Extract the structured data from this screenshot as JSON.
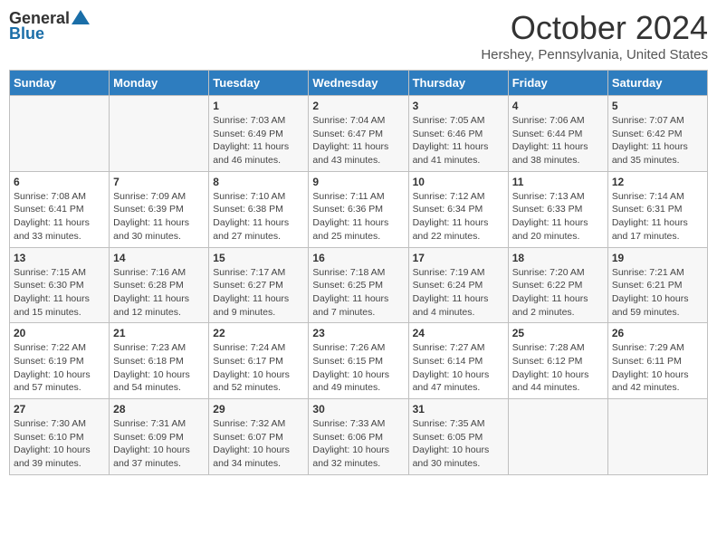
{
  "header": {
    "logo_general": "General",
    "logo_blue": "Blue",
    "title": "October 2024",
    "location": "Hershey, Pennsylvania, United States"
  },
  "days_of_week": [
    "Sunday",
    "Monday",
    "Tuesday",
    "Wednesday",
    "Thursday",
    "Friday",
    "Saturday"
  ],
  "weeks": [
    [
      {
        "day": "",
        "info": ""
      },
      {
        "day": "",
        "info": ""
      },
      {
        "day": "1",
        "info": "Sunrise: 7:03 AM\nSunset: 6:49 PM\nDaylight: 11 hours and 46 minutes."
      },
      {
        "day": "2",
        "info": "Sunrise: 7:04 AM\nSunset: 6:47 PM\nDaylight: 11 hours and 43 minutes."
      },
      {
        "day": "3",
        "info": "Sunrise: 7:05 AM\nSunset: 6:46 PM\nDaylight: 11 hours and 41 minutes."
      },
      {
        "day": "4",
        "info": "Sunrise: 7:06 AM\nSunset: 6:44 PM\nDaylight: 11 hours and 38 minutes."
      },
      {
        "day": "5",
        "info": "Sunrise: 7:07 AM\nSunset: 6:42 PM\nDaylight: 11 hours and 35 minutes."
      }
    ],
    [
      {
        "day": "6",
        "info": "Sunrise: 7:08 AM\nSunset: 6:41 PM\nDaylight: 11 hours and 33 minutes."
      },
      {
        "day": "7",
        "info": "Sunrise: 7:09 AM\nSunset: 6:39 PM\nDaylight: 11 hours and 30 minutes."
      },
      {
        "day": "8",
        "info": "Sunrise: 7:10 AM\nSunset: 6:38 PM\nDaylight: 11 hours and 27 minutes."
      },
      {
        "day": "9",
        "info": "Sunrise: 7:11 AM\nSunset: 6:36 PM\nDaylight: 11 hours and 25 minutes."
      },
      {
        "day": "10",
        "info": "Sunrise: 7:12 AM\nSunset: 6:34 PM\nDaylight: 11 hours and 22 minutes."
      },
      {
        "day": "11",
        "info": "Sunrise: 7:13 AM\nSunset: 6:33 PM\nDaylight: 11 hours and 20 minutes."
      },
      {
        "day": "12",
        "info": "Sunrise: 7:14 AM\nSunset: 6:31 PM\nDaylight: 11 hours and 17 minutes."
      }
    ],
    [
      {
        "day": "13",
        "info": "Sunrise: 7:15 AM\nSunset: 6:30 PM\nDaylight: 11 hours and 15 minutes."
      },
      {
        "day": "14",
        "info": "Sunrise: 7:16 AM\nSunset: 6:28 PM\nDaylight: 11 hours and 12 minutes."
      },
      {
        "day": "15",
        "info": "Sunrise: 7:17 AM\nSunset: 6:27 PM\nDaylight: 11 hours and 9 minutes."
      },
      {
        "day": "16",
        "info": "Sunrise: 7:18 AM\nSunset: 6:25 PM\nDaylight: 11 hours and 7 minutes."
      },
      {
        "day": "17",
        "info": "Sunrise: 7:19 AM\nSunset: 6:24 PM\nDaylight: 11 hours and 4 minutes."
      },
      {
        "day": "18",
        "info": "Sunrise: 7:20 AM\nSunset: 6:22 PM\nDaylight: 11 hours and 2 minutes."
      },
      {
        "day": "19",
        "info": "Sunrise: 7:21 AM\nSunset: 6:21 PM\nDaylight: 10 hours and 59 minutes."
      }
    ],
    [
      {
        "day": "20",
        "info": "Sunrise: 7:22 AM\nSunset: 6:19 PM\nDaylight: 10 hours and 57 minutes."
      },
      {
        "day": "21",
        "info": "Sunrise: 7:23 AM\nSunset: 6:18 PM\nDaylight: 10 hours and 54 minutes."
      },
      {
        "day": "22",
        "info": "Sunrise: 7:24 AM\nSunset: 6:17 PM\nDaylight: 10 hours and 52 minutes."
      },
      {
        "day": "23",
        "info": "Sunrise: 7:26 AM\nSunset: 6:15 PM\nDaylight: 10 hours and 49 minutes."
      },
      {
        "day": "24",
        "info": "Sunrise: 7:27 AM\nSunset: 6:14 PM\nDaylight: 10 hours and 47 minutes."
      },
      {
        "day": "25",
        "info": "Sunrise: 7:28 AM\nSunset: 6:12 PM\nDaylight: 10 hours and 44 minutes."
      },
      {
        "day": "26",
        "info": "Sunrise: 7:29 AM\nSunset: 6:11 PM\nDaylight: 10 hours and 42 minutes."
      }
    ],
    [
      {
        "day": "27",
        "info": "Sunrise: 7:30 AM\nSunset: 6:10 PM\nDaylight: 10 hours and 39 minutes."
      },
      {
        "day": "28",
        "info": "Sunrise: 7:31 AM\nSunset: 6:09 PM\nDaylight: 10 hours and 37 minutes."
      },
      {
        "day": "29",
        "info": "Sunrise: 7:32 AM\nSunset: 6:07 PM\nDaylight: 10 hours and 34 minutes."
      },
      {
        "day": "30",
        "info": "Sunrise: 7:33 AM\nSunset: 6:06 PM\nDaylight: 10 hours and 32 minutes."
      },
      {
        "day": "31",
        "info": "Sunrise: 7:35 AM\nSunset: 6:05 PM\nDaylight: 10 hours and 30 minutes."
      },
      {
        "day": "",
        "info": ""
      },
      {
        "day": "",
        "info": ""
      }
    ]
  ]
}
